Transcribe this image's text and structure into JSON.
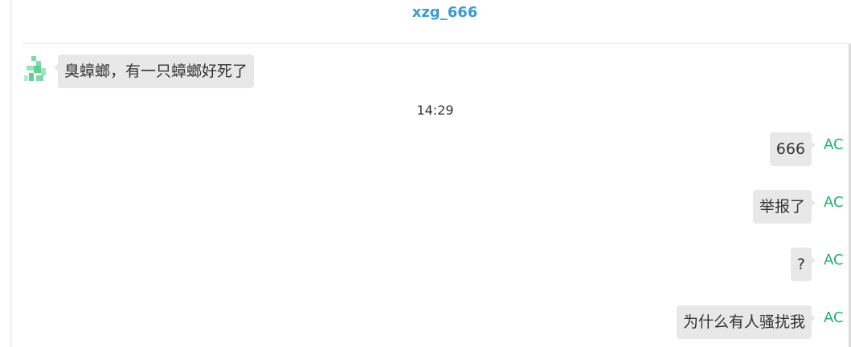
{
  "header": {
    "title": "xzg_666"
  },
  "colors": {
    "title": "#3d9ad6",
    "sender_tag": "#21b36a",
    "bubble_bg": "#e8e8e8"
  },
  "messages": {
    "incoming": [
      {
        "text": "臭蟑螂，有一只蟑螂好死了",
        "avatar": "green-pixel-avatar-icon"
      }
    ],
    "timestamp": "14:29",
    "outgoing": [
      {
        "text": "666",
        "sender": "AC"
      },
      {
        "text": "举报了",
        "sender": "AC"
      },
      {
        "text": "?",
        "sender": "AC"
      },
      {
        "text": "为什么有人骚扰我",
        "sender": "AC"
      }
    ]
  }
}
